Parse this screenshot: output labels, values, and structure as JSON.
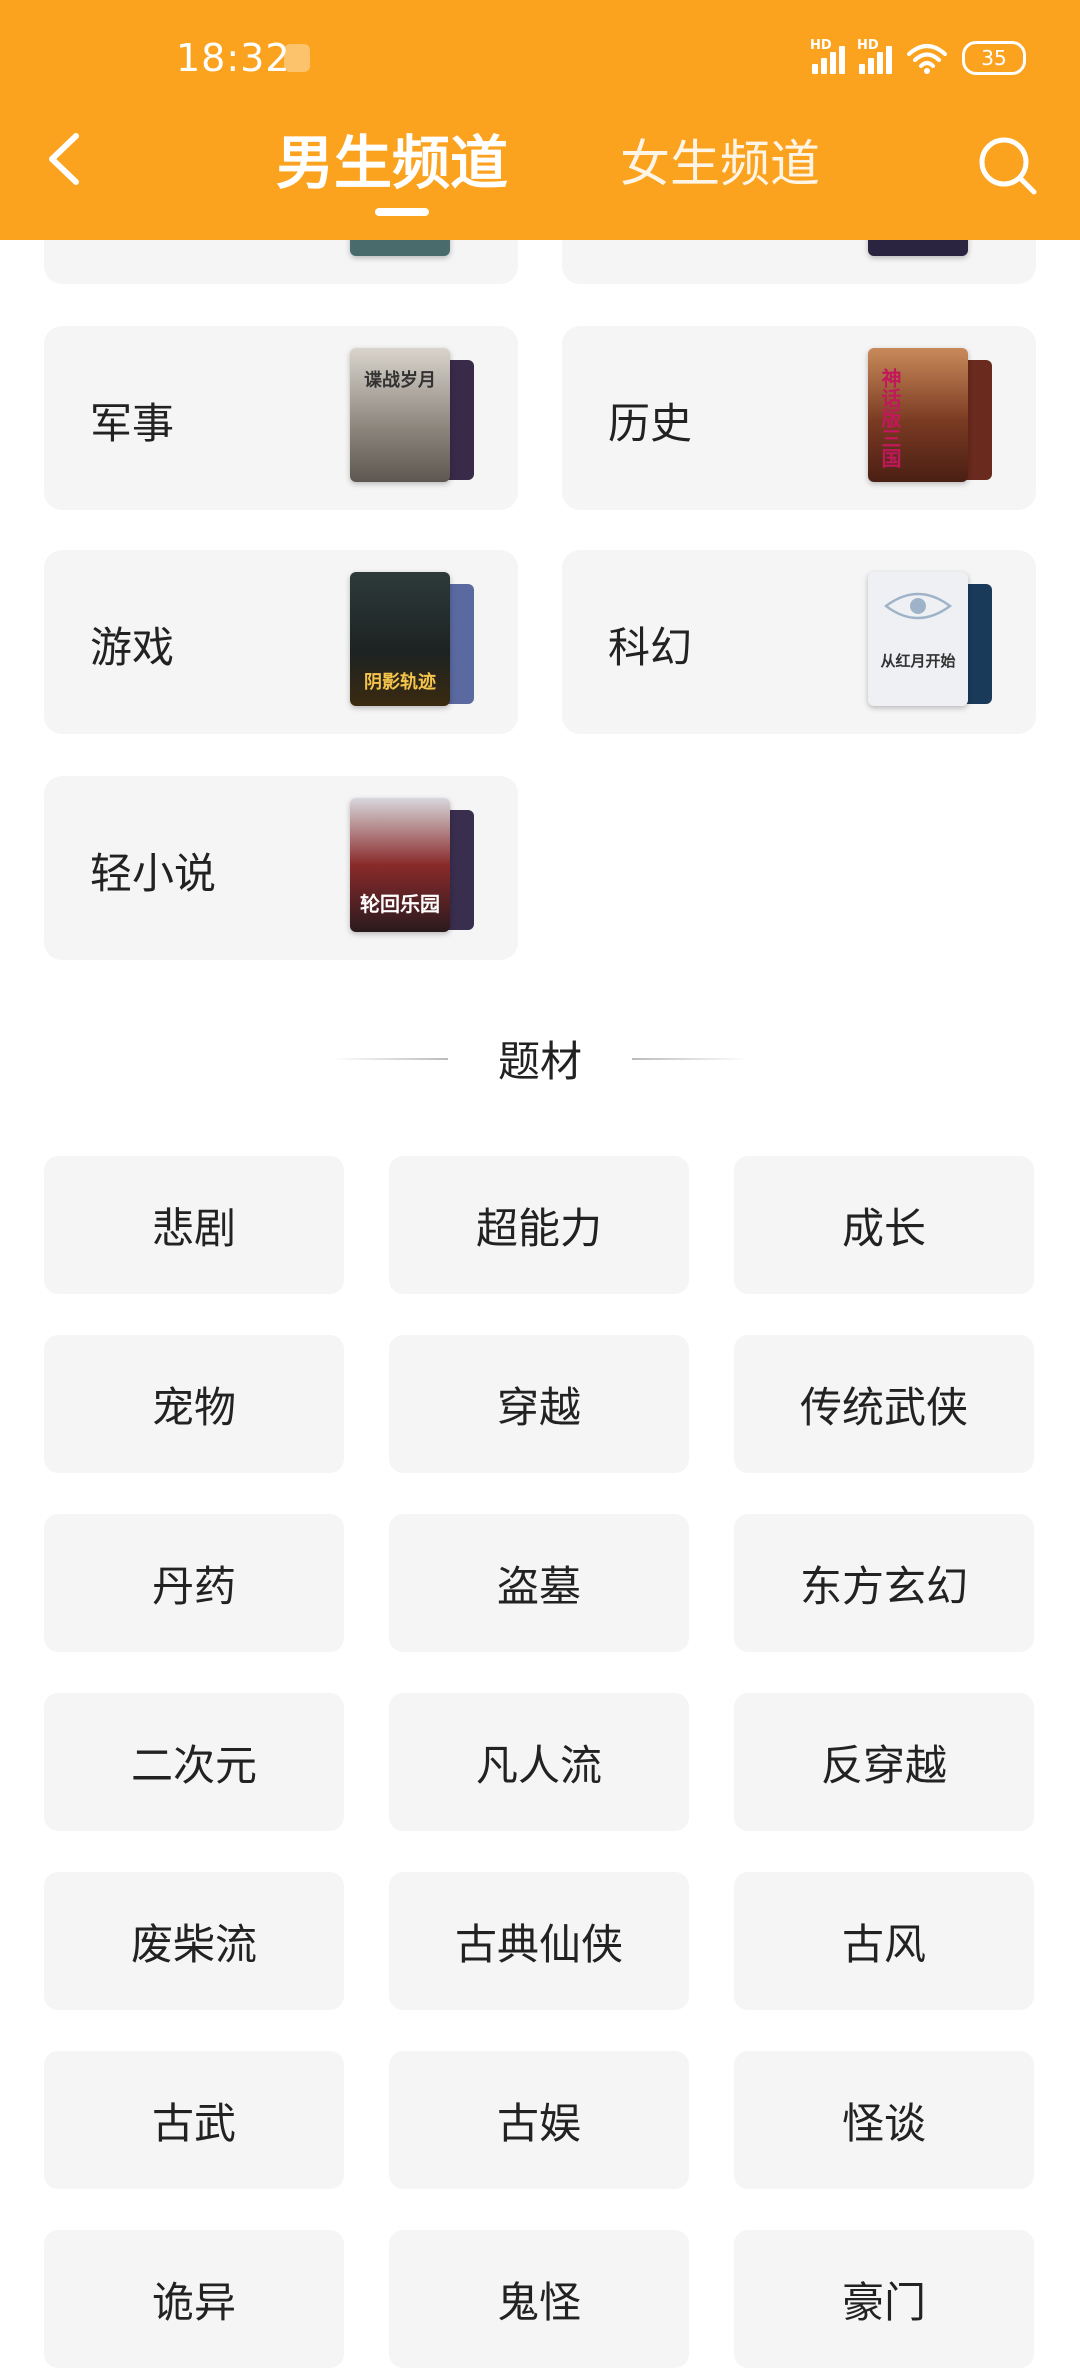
{
  "status_bar": {
    "time": "18:32",
    "battery": "35",
    "signal_label": "HD"
  },
  "header": {
    "tabs": [
      {
        "label": "男生频道",
        "active": true
      },
      {
        "label": "女生频道",
        "active": false
      }
    ],
    "accent_color": "#FBA21E"
  },
  "categories": [
    {
      "label": "军事",
      "cover_title": "谍战岁月"
    },
    {
      "label": "历史",
      "cover_title": "神话版三国"
    },
    {
      "label": "游戏",
      "cover_title": "阴影轨迹"
    },
    {
      "label": "科幻",
      "cover_title": "从红月开始"
    },
    {
      "label": "轻小说",
      "cover_title": "轮回乐园"
    }
  ],
  "section": {
    "title": "题材"
  },
  "tags": [
    "悲剧",
    "超能力",
    "成长",
    "宠物",
    "穿越",
    "传统武侠",
    "丹药",
    "盗墓",
    "东方玄幻",
    "二次元",
    "凡人流",
    "反穿越",
    "废柴流",
    "古典仙侠",
    "古风",
    "古武",
    "古娱",
    "怪谈",
    "诡异",
    "鬼怪",
    "豪门"
  ],
  "icons": {
    "back": "chevron-left-icon",
    "search": "search-icon"
  }
}
